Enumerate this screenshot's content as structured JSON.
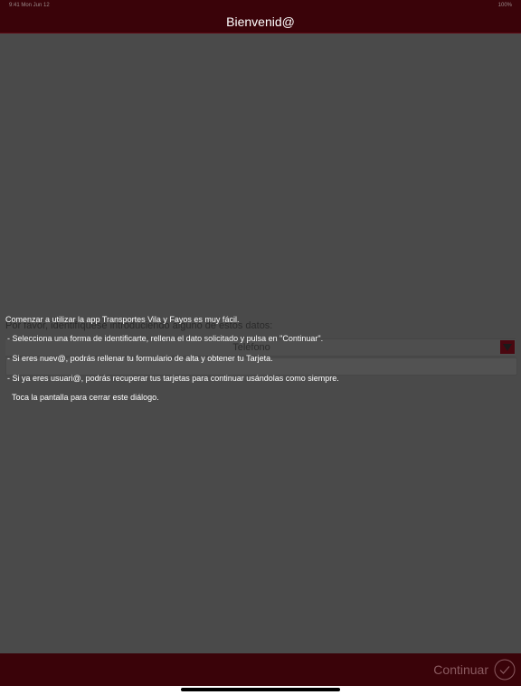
{
  "status_bar": {
    "left": "9:41  Mon Jun 12",
    "right": "100%"
  },
  "header": {
    "title": "Bienvenid@"
  },
  "form": {
    "prompt": "Por favor, identifíquese introduciendo alguno de estos datos:",
    "select_value": "Teléfono",
    "input_value": ""
  },
  "dialog": {
    "line1": "Comenzar a utilizar la app Transportes Vila y Fayos es muy fácil.",
    "line2": "- Selecciona una forma de identificarte, rellena el dato solicitado y pulsa en \"Continuar\".",
    "line3": "- Si eres nuev@, podrás rellenar tu formulario de alta y obtener tu Tarjeta.",
    "line4": "- Si ya eres usuari@, podrás recuperar tus tarjetas para continuar usándolas como siempre.",
    "line5": "Toca la pantalla para cerrar este diálogo."
  },
  "footer": {
    "continue_label": "Continuar"
  },
  "colors": {
    "brand": "#3a0309",
    "background": "#4a4a4a"
  }
}
